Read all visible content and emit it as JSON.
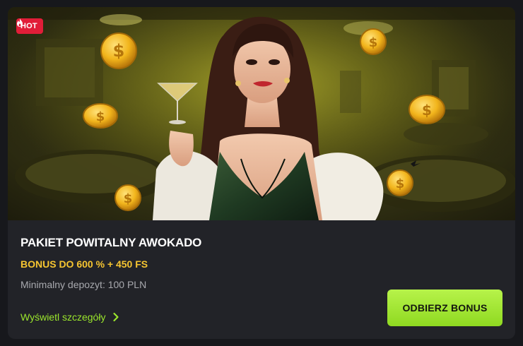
{
  "promo": {
    "badge": "HOT",
    "title": "PAKIET POWITALNY AWOKADO",
    "bonus": "BONUS DO 600 % + 450 FS",
    "min_deposit": "Minimalny depozyt: 100 PLN",
    "details_link": "Wyświetl szczegóły",
    "claim_button": "ODBIERZ BONUS",
    "image_icon": "casino-hostess-banner",
    "colors": {
      "card_bg": "#222328",
      "badge": "#e11d38",
      "bonus_text": "#f6c531",
      "link": "#9be62c",
      "button": "#a6ea35"
    }
  }
}
